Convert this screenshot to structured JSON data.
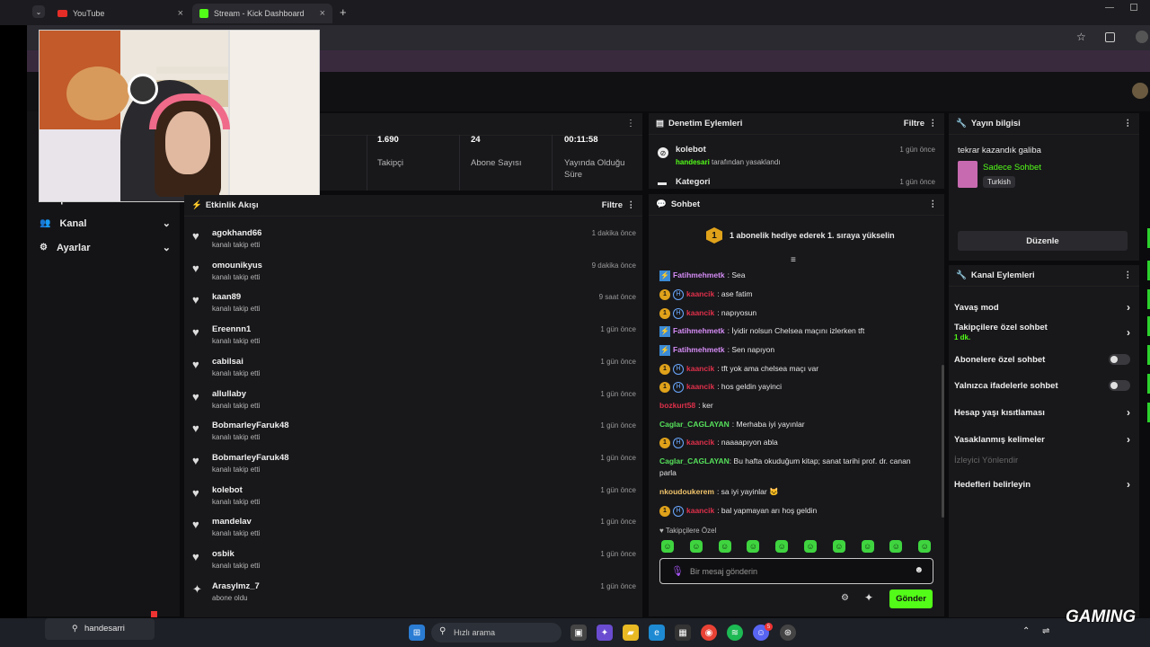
{
  "browser": {
    "tabs": [
      {
        "label": "YouTube"
      },
      {
        "label": "Stream - Kick Dashboard"
      }
    ],
    "new_tab": "+"
  },
  "sidebar": {
    "partial_item": "Sahip",
    "items": [
      {
        "label": "Kanal"
      },
      {
        "label": "Ayarlar"
      }
    ]
  },
  "stats": [
    {
      "value": "1.690",
      "label": "Takipçi"
    },
    {
      "value": "24",
      "label": "Abone Sayısı"
    },
    {
      "value": "00:11:58",
      "label": "Yayında Olduğu Süre"
    }
  ],
  "moderation": {
    "title": "Denetim Eylemleri",
    "filter": "Filtre",
    "entries": [
      {
        "name": "kolebot",
        "actor": "handesari",
        "text": "tarafından yasaklandı",
        "time": "1 gün önce"
      },
      {
        "name": "Kategori",
        "time": "1 gün önce"
      }
    ]
  },
  "activity": {
    "title": "Etkinlik Akışı",
    "filter": "Filtre",
    "rows": [
      {
        "name": "agokhand66",
        "sub": "kanalı takip etti",
        "time": "1 dakika önce"
      },
      {
        "name": "omounikyus",
        "sub": "kanalı takip etti",
        "time": "9 dakika önce"
      },
      {
        "name": "kaan89",
        "sub": "kanalı takip etti",
        "time": "9 saat önce"
      },
      {
        "name": "Ereennn1",
        "sub": "kanalı takip etti",
        "time": "1 gün önce"
      },
      {
        "name": "cabilsai",
        "sub": "kanalı takip etti",
        "time": "1 gün önce"
      },
      {
        "name": "allullaby",
        "sub": "kanalı takip etti",
        "time": "1 gün önce"
      },
      {
        "name": "BobmarleyFaruk48",
        "sub": "kanalı takip etti",
        "time": "1 gün önce"
      },
      {
        "name": "BobmarleyFaruk48",
        "sub": "kanalı takip etti",
        "time": "1 gün önce"
      },
      {
        "name": "kolebot",
        "sub": "kanalı takip etti",
        "time": "1 gün önce"
      },
      {
        "name": "mandelav",
        "sub": "kanalı takip etti",
        "time": "1 gün önce"
      },
      {
        "name": "osbik",
        "sub": "kanalı takip etti",
        "time": "1 gün önce"
      },
      {
        "name": "Arasylmz_7",
        "sub": "abone oldu",
        "time": "1 gün önce"
      }
    ]
  },
  "chat": {
    "title": "Sohbet",
    "gift_rank": "1",
    "gift_text": "1 abonelik hediye ederek 1. sıraya yükselin",
    "messages": [
      {
        "user": "Fatihmehmetk",
        "color": "#d58cf5",
        "badges": "bolt",
        "text": ": Sea"
      },
      {
        "user": "kaancik",
        "color": "#e0304a",
        "badges": "subh",
        "text": ": ase fatim"
      },
      {
        "user": "kaancik",
        "color": "#e0304a",
        "badges": "subh",
        "text": ": napıyosun"
      },
      {
        "user": "Fatihmehmetk",
        "color": "#d58cf5",
        "badges": "bolt",
        "text": ": İyidir nolsun Chelsea maçını izlerken tft"
      },
      {
        "user": "Fatihmehmetk",
        "color": "#d58cf5",
        "badges": "bolt",
        "text": ": Sen napıyon"
      },
      {
        "user": "kaancik",
        "color": "#e0304a",
        "badges": "subh",
        "text": ": tft yok ama chelsea maçı var"
      },
      {
        "user": "kaancik",
        "color": "#e0304a",
        "badges": "subh",
        "text": ": hos geldin yayinci"
      },
      {
        "user": "bozkurt58",
        "color": "#e0304a",
        "badges": "",
        "text": ": ker"
      },
      {
        "user": "Caglar_CAGLAYAN",
        "color": "#56e05a",
        "badges": "",
        "text": ": Merhaba iyi yayınlar"
      },
      {
        "user": "kaancik",
        "color": "#e0304a",
        "badges": "subh",
        "text": ": naaaapıyon abla"
      },
      {
        "user": "Caglar_CAGLAYAN",
        "color": "#56e05a",
        "badges": "",
        "text": ": Bu hafta okuduğum kitap; sanat tarihi prof. dr. canan parla"
      },
      {
        "user": "nkoudoukerem",
        "color": "#f0c36a",
        "badges": "",
        "text": ": sa iyi yayinlar 🐱"
      },
      {
        "user": "kaancik",
        "color": "#e0304a",
        "badges": "subh",
        "text": ": bal yapmayan arı hoş geldin"
      }
    ],
    "followers_only": "Takipçilere Özel",
    "placeholder": "Bir mesaj gönderin",
    "send": "Gönder",
    "sub_badge": "1",
    "h_badge": "H"
  },
  "stream_info": {
    "title_label": "Yayın bilgisi",
    "stream_title": "tekrar kazandık galiba",
    "category": "Sadece Sohbet",
    "language": "Turkish",
    "edit": "Düzenle"
  },
  "channel_actions": {
    "title": "Kanal Eylemleri",
    "items": [
      {
        "label": "Yavaş mod"
      },
      {
        "label": "Takipçilere özel sohbet",
        "sub": "1 dk."
      },
      {
        "label": "Abonelere özel sohbet"
      },
      {
        "label": "Yalnızca ifadelerle sohbet"
      },
      {
        "label": "Hesap yaşı kısıtlaması"
      },
      {
        "label": "Yasaklanmış kelimeler"
      },
      {
        "label": "İzleyici Yönlendir"
      },
      {
        "label": "Hedefleri belirleyin"
      }
    ]
  },
  "taskbar": {
    "user": "handesarri",
    "search": "Hızlı arama",
    "discord_badge": "5"
  },
  "watermark": "GAMING",
  "colors": {
    "accent": "#53fc18",
    "panel": "#18181b"
  }
}
